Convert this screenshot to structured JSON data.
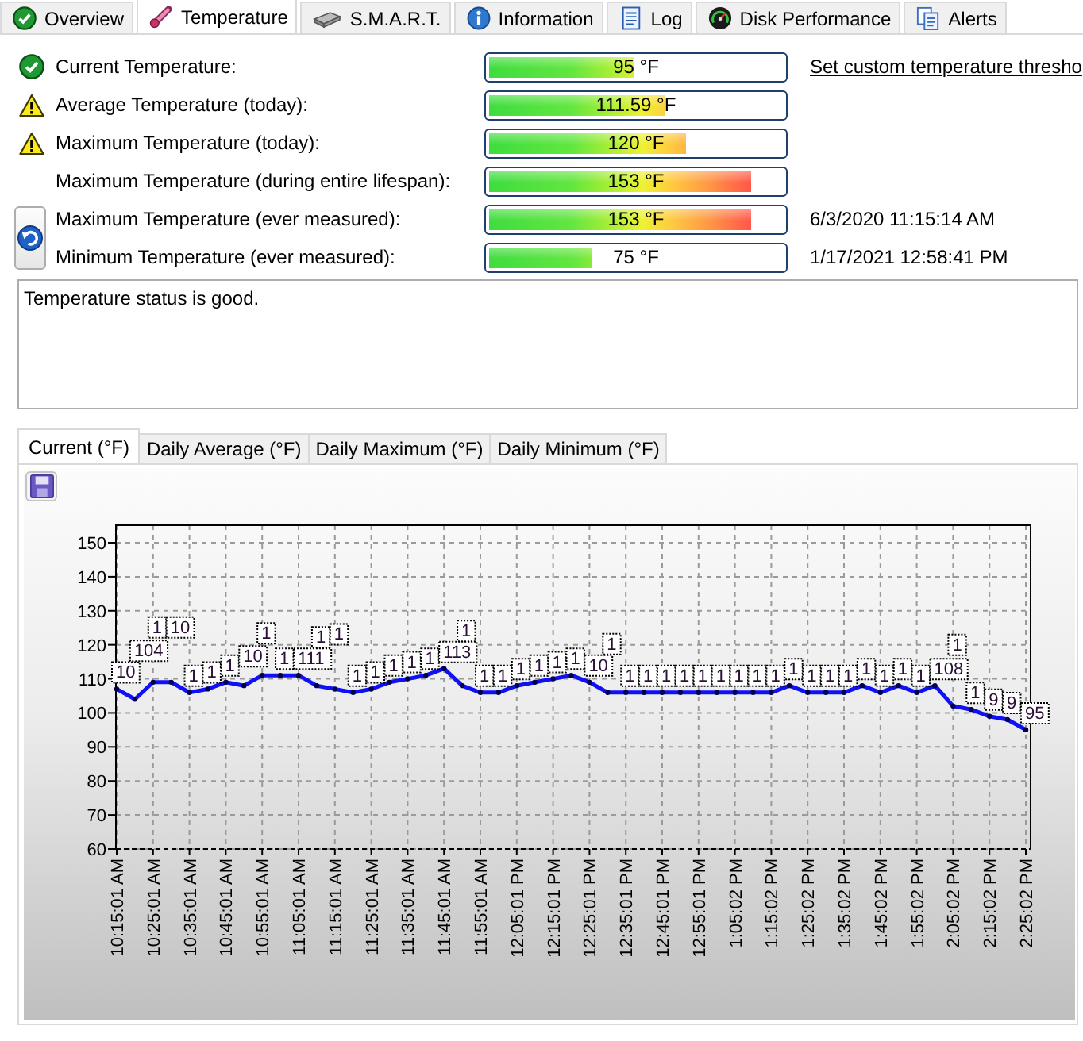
{
  "tabs": [
    {
      "label": "Overview",
      "selected": false
    },
    {
      "label": "Temperature",
      "selected": true
    },
    {
      "label": "S.M.A.R.T.",
      "selected": false
    },
    {
      "label": "Information",
      "selected": false
    },
    {
      "label": "Log",
      "selected": false
    },
    {
      "label": "Disk Performance",
      "selected": false
    },
    {
      "label": "Alerts",
      "selected": false
    }
  ],
  "readings": [
    {
      "kind": "ok",
      "label": "Current Temperature:",
      "value": "95 °F",
      "level": 0.49
    },
    {
      "kind": "warning",
      "label": "Average Temperature (today):",
      "value": "111.59 °F",
      "level": 0.6
    },
    {
      "kind": "warning",
      "label": "Maximum Temperature (today):",
      "value": "120 °F",
      "level": 0.67
    },
    {
      "kind": "plain",
      "label": "Maximum Temperature (during entire lifespan):",
      "value": "153 °F",
      "level": 0.89
    },
    {
      "kind": "plain",
      "label": "Maximum Temperature (ever measured):",
      "value": "153 °F",
      "level": 0.89,
      "timestamp": "6/3/2020 11:15:14 AM"
    },
    {
      "kind": "plain",
      "label": "Minimum Temperature (ever measured):",
      "value": "75 °F",
      "level": 0.35,
      "timestamp": "1/17/2021 12:58:41 PM"
    }
  ],
  "threshold_link": "Set custom temperature thresho",
  "status_message": "Temperature status is good.",
  "chart_tabs": [
    {
      "label": "Current (°F)",
      "selected": true
    },
    {
      "label": "Daily Average (°F)",
      "selected": false
    },
    {
      "label": "Daily Maximum (°F)",
      "selected": false
    },
    {
      "label": "Daily Minimum (°F)",
      "selected": false
    }
  ],
  "chart": {
    "chart_data": {
      "type": "line",
      "grid": true,
      "marker": "circle",
      "categories": [
        "10:15:01 AM",
        null,
        "10:25:01 AM",
        null,
        "10:35:01 AM",
        null,
        "10:45:01 AM",
        null,
        "10:55:01 AM",
        null,
        "11:05:01 AM",
        null,
        "11:15:01 AM",
        null,
        "11:25:01 AM",
        null,
        "11:35:01 AM",
        null,
        "11:45:01 AM",
        null,
        "11:55:01 AM",
        null,
        "12:05:01 PM",
        null,
        "12:15:01 PM",
        null,
        "12:25:01 PM",
        null,
        "12:35:01 PM",
        null,
        "12:45:01 PM",
        null,
        "12:55:01 PM",
        null,
        "1:05:02 PM",
        null,
        "1:15:02 PM",
        null,
        "1:25:02 PM",
        null,
        "1:35:02 PM",
        null,
        "1:45:02 PM",
        null,
        "1:55:02 PM",
        null,
        "2:05:02 PM",
        null,
        "2:15:02 PM",
        null,
        "2:25:02 PM"
      ],
      "ylim": [
        60,
        150
      ],
      "yticks": [
        60,
        70,
        80,
        90,
        100,
        110,
        120,
        130,
        140,
        150
      ],
      "values": [
        107,
        104,
        109,
        109,
        106,
        107,
        109,
        108,
        111,
        111,
        111,
        108,
        107,
        106,
        107,
        109,
        110,
        111,
        113,
        108,
        106,
        106,
        108,
        109,
        110,
        111,
        109,
        106,
        106,
        106,
        106,
        106,
        106,
        106,
        106,
        106,
        106,
        108,
        106,
        106,
        106,
        108,
        106,
        108,
        106,
        108,
        102,
        101,
        99,
        98,
        95
      ]
    },
    "point_labels": [
      "10",
      "104",
      "1",
      "10",
      "1",
      "1",
      "1",
      "10",
      "1",
      "1",
      "111",
      "1",
      "1",
      "1",
      "1",
      "1",
      "1",
      "1",
      "113",
      "1",
      "1",
      "1",
      "1",
      "1",
      "1",
      "1",
      "10",
      "1",
      "1",
      "1",
      "1",
      "1",
      "1",
      "1",
      "1",
      "1",
      "1",
      "1",
      "1",
      "1",
      "1",
      "1",
      "1",
      "1",
      "1",
      "108",
      "1",
      "1",
      "9",
      "9",
      "95"
    ]
  }
}
